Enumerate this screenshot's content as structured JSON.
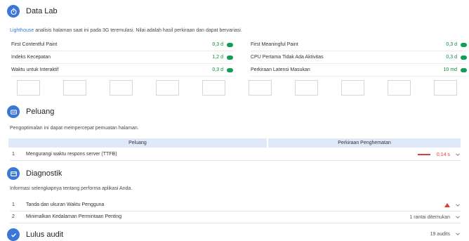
{
  "data_lab": {
    "title": "Data Lab",
    "description_link": "Lighthouse",
    "description_rest": " analisis halaman saat ini pada 3G teremulasi. Nilai adalah hasil perkiraan dan dapat bervariasi.",
    "metrics_left": [
      {
        "label": "First Contentful Paint",
        "value": "0,3 d",
        "status": "pass"
      },
      {
        "label": "Indeks Kecepatan",
        "value": "1,2 d",
        "status": "pass"
      },
      {
        "label": "Waktu untuk Interaktif",
        "value": "0,3 d",
        "status": "pass"
      }
    ],
    "metrics_right": [
      {
        "label": "First Meaningful Paint",
        "value": "0,3 d",
        "status": "pass"
      },
      {
        "label": "CPU Pertama Tidak Ada Aktivitas",
        "value": "0,3 d",
        "status": "pass"
      },
      {
        "label": "Perkiraan Latensi Masukan",
        "value": "10 md",
        "status": "pass"
      }
    ],
    "filmstrip_frames": 10
  },
  "peluang": {
    "title": "Peluang",
    "description": "Pengoptimalan ini dapat mempercepat pemuatan halaman.",
    "col_opportunity": "Peluang",
    "col_savings": "Perkiraan Penghematan",
    "items": [
      {
        "num": "1",
        "label": "Mengurangi waktu respons server (TTFB)",
        "value": "0,14 s"
      }
    ]
  },
  "diagnostik": {
    "title": "Diagnostik",
    "description": "Informasi selengkapnya tentang performa aplikasi Anda.",
    "items": [
      {
        "num": "1",
        "label": "Tanda dan ukuran Waktu Pengguna",
        "extra": ""
      },
      {
        "num": "2",
        "label": "Minimalkan Kedalaman Permintaan Penting",
        "extra": "1 rantai ditemukan"
      }
    ]
  },
  "lulus_audit": {
    "title": "Lulus audit",
    "count": "19 audits"
  },
  "colors": {
    "accent": "#3a77d6",
    "pass": "#0f9d58",
    "fail": "#e53935",
    "table_header": "#dfe9f8"
  }
}
